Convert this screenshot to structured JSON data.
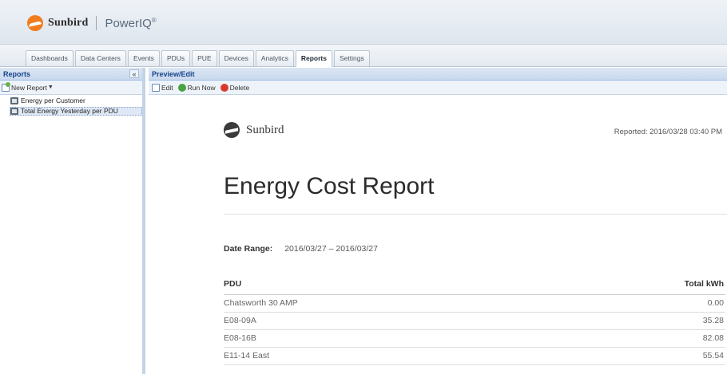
{
  "header": {
    "brand": "Sunbird",
    "product": "PowerIQ",
    "trademark": "®"
  },
  "nav": {
    "tabs": [
      {
        "label": "Dashboards",
        "active": false
      },
      {
        "label": "Data Centers",
        "active": false
      },
      {
        "label": "Events",
        "active": false
      },
      {
        "label": "PDUs",
        "active": false
      },
      {
        "label": "PUE",
        "active": false
      },
      {
        "label": "Devices",
        "active": false
      },
      {
        "label": "Analytics",
        "active": false
      },
      {
        "label": "Reports",
        "active": true
      },
      {
        "label": "Settings",
        "active": false
      }
    ]
  },
  "left_panel": {
    "title": "Reports",
    "collapse_label": "«",
    "new_report_label": "New Report",
    "items": [
      {
        "label": "Energy per Customer",
        "selected": false
      },
      {
        "label": "Total Energy Yesterday per PDU",
        "selected": true
      }
    ]
  },
  "right_panel": {
    "title": "Preview/Edit",
    "toolbar": {
      "edit": "Edit",
      "run_now": "Run Now",
      "delete": "Delete"
    }
  },
  "report": {
    "brand": "Sunbird",
    "reported": "Reported: 2016/03/28 03:40 PM",
    "title": "Energy Cost Report",
    "date_range_label": "Date Range:",
    "date_range_value": "2016/03/27 – 2016/03/27",
    "table": {
      "columns": [
        "PDU",
        "Total kWh"
      ],
      "rows": [
        {
          "pdu": "Chatsworth 30 AMP",
          "kwh": "0.00"
        },
        {
          "pdu": "E08-09A",
          "kwh": "35.28"
        },
        {
          "pdu": "E08-16B",
          "kwh": "82.08"
        },
        {
          "pdu": "E11-14 East",
          "kwh": "55.54"
        }
      ]
    }
  },
  "colors": {
    "accent_orange": "#f07c1e",
    "panel_header_text": "#15428b",
    "panel_border": "#99bbe8"
  }
}
